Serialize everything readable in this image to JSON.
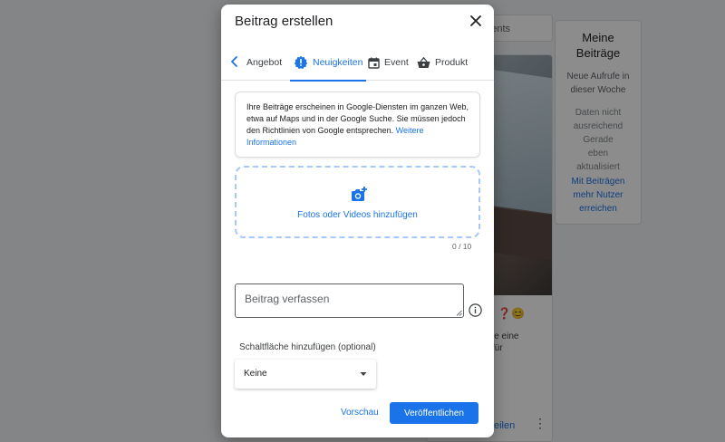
{
  "background": {
    "tab_partial": "ents",
    "post_emoji": "❓😊",
    "post_text_line1": "le eine",
    "post_text_line2": "für",
    "post_link_partial": "eilen",
    "side_card": {
      "title": "Meine Beiträge",
      "subtitle": "Neue Aufrufe in dieser Woche",
      "empty_text": "Daten nicht ausreichend Gerade eben aktualisiert",
      "cta": "Mit Beiträgen mehr Nutzer erreichen"
    }
  },
  "dialog": {
    "title": "Beitrag erstellen",
    "tabs": [
      {
        "label": "Angebot",
        "icon": "chevron-left-icon"
      },
      {
        "label": "Neuigkeiten",
        "icon": "news-badge-icon",
        "active": true
      },
      {
        "label": "Event",
        "icon": "calendar-icon"
      },
      {
        "label": "Produkt",
        "icon": "basket-icon"
      }
    ],
    "info_text": "Ihre Beiträge erscheinen in Google-Diensten im ganzen Web, etwa auf Maps und in der Google Suche. Sie müssen jedoch den Richtlinien von Google entsprechen.",
    "info_link": "Weitere Informationen",
    "upload_label": "Fotos oder Videos hinzufügen",
    "upload_counter": "0 / 10",
    "compose_placeholder": "Beitrag verfassen",
    "button_section_label": "Schaltfläche hinzufügen (optional)",
    "button_select_value": "Keine",
    "preview_label": "Vorschau",
    "publish_label": "Veröffentlichen"
  },
  "colors": {
    "accent": "#1a73e8",
    "dashed_border": "#a8c7fa"
  }
}
